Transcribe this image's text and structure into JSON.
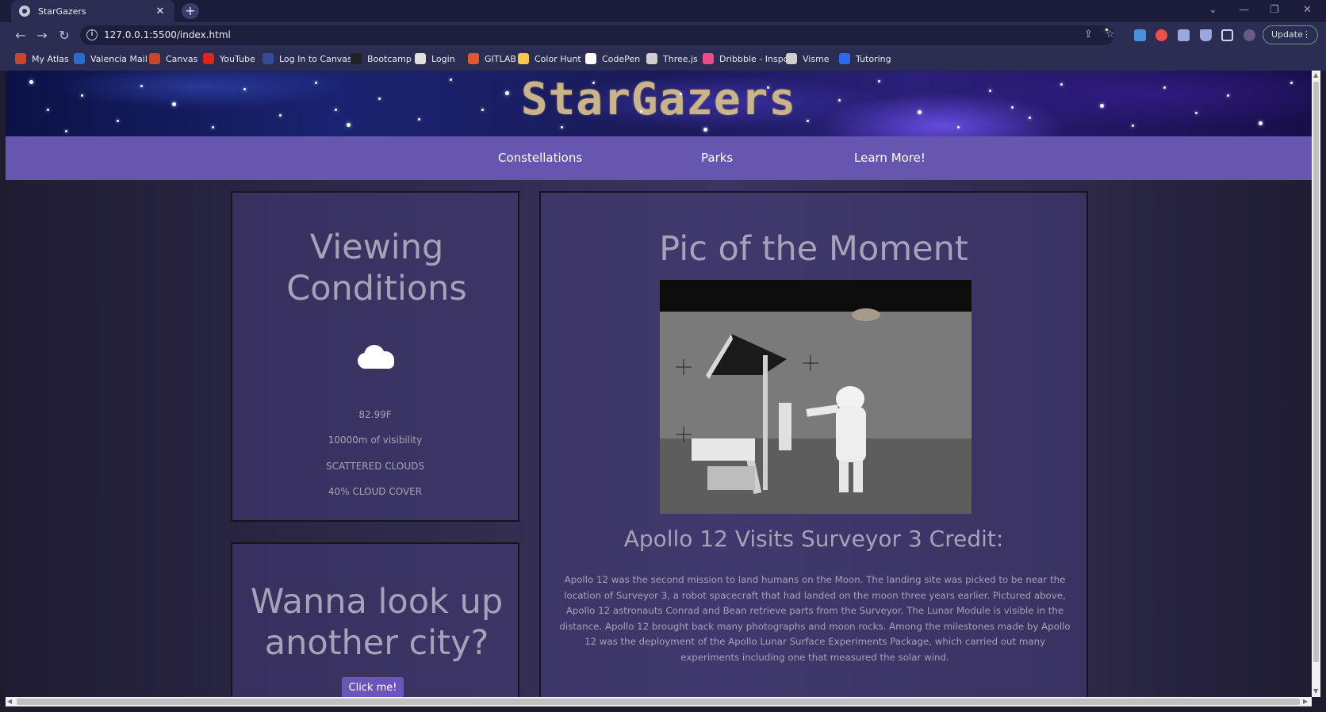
{
  "browser": {
    "tab_title": "StarGazers",
    "tab_close": "✕",
    "new_tab": "+",
    "url": "127.0.0.1:5500/index.html",
    "update_label": "Update",
    "update_menu": "⋮",
    "window_controls": {
      "chevron": "⌄",
      "minimize": "—",
      "restore": "❐",
      "close": "✕"
    },
    "nav": {
      "back": "←",
      "forward": "→",
      "reload": "↻"
    },
    "bookmarks": [
      {
        "label": "My Atlas",
        "icon": "atlas-icon",
        "color": "#c8462c"
      },
      {
        "label": "Valencia Mail",
        "icon": "outlook-icon",
        "color": "#2a6cc8"
      },
      {
        "label": "Canvas",
        "icon": "canvas-icon",
        "color": "#c8462c"
      },
      {
        "label": "YouTube",
        "icon": "youtube-icon",
        "color": "#e62117"
      },
      {
        "label": "Log In to Canvas",
        "icon": "canvas-login-icon",
        "color": "#3a4a9a"
      },
      {
        "label": "Bootcamp",
        "icon": "bootcamp-icon",
        "color": "#222222"
      },
      {
        "label": "Login",
        "icon": "login-icon",
        "color": "#e0e0e0"
      },
      {
        "label": "GITLAB",
        "icon": "gitlab-icon",
        "color": "#e2572c"
      },
      {
        "label": "Color Hunt",
        "icon": "colorhunt-icon",
        "color": "#f6c84a"
      },
      {
        "label": "CodePen",
        "icon": "codepen-icon",
        "color": "#ffffff"
      },
      {
        "label": "Three.js",
        "icon": "threejs-icon",
        "color": "#cfcfcf"
      },
      {
        "label": "Dribbble - Inspo",
        "icon": "dribbble-icon",
        "color": "#ea4c89"
      },
      {
        "label": "Visme",
        "icon": "visme-icon",
        "color": "#cfcfcf"
      },
      {
        "label": "Tutoring",
        "icon": "tutoring-icon",
        "color": "#2a6cf0"
      }
    ]
  },
  "site": {
    "brand": "StarGazers",
    "nav": [
      "Constellations",
      "Parks",
      "Learn More!"
    ]
  },
  "conditions": {
    "heading": "Viewing Conditions",
    "icon": "cloud-icon",
    "temperature": "82.99F",
    "visibility": "10000m of visibility",
    "description": "SCATTERED CLOUDS",
    "cloud_cover": "40% CLOUD COVER"
  },
  "lookup": {
    "heading": "Wanna look up another city?",
    "button": "Click me!"
  },
  "pic": {
    "heading": "Pic of the Moment",
    "caption_title": "Apollo 12 Visits Surveyor 3 Credit:",
    "caption_body": "Apollo 12 was the second mission to land humans on the Moon. The landing site was picked to be near the location of Surveyor 3, a robot spacecraft that had landed on the moon three years earlier. Pictured above, Apollo 12 astronauts Conrad and Bean retrieve parts from the Surveyor. The Lunar Module is visible in the distance. Apollo 12 brought back many photographs and moon rocks. Among the milestones made by Apollo 12 was the deployment of the Apollo Lunar Surface Experiments Package, which carried out many experiments including one that measured the solar wind."
  },
  "colors": {
    "navbar": "#6656b0",
    "brand": "#cbb48a",
    "panel_text": "#a8a2b8",
    "button": "#6a56b8"
  }
}
